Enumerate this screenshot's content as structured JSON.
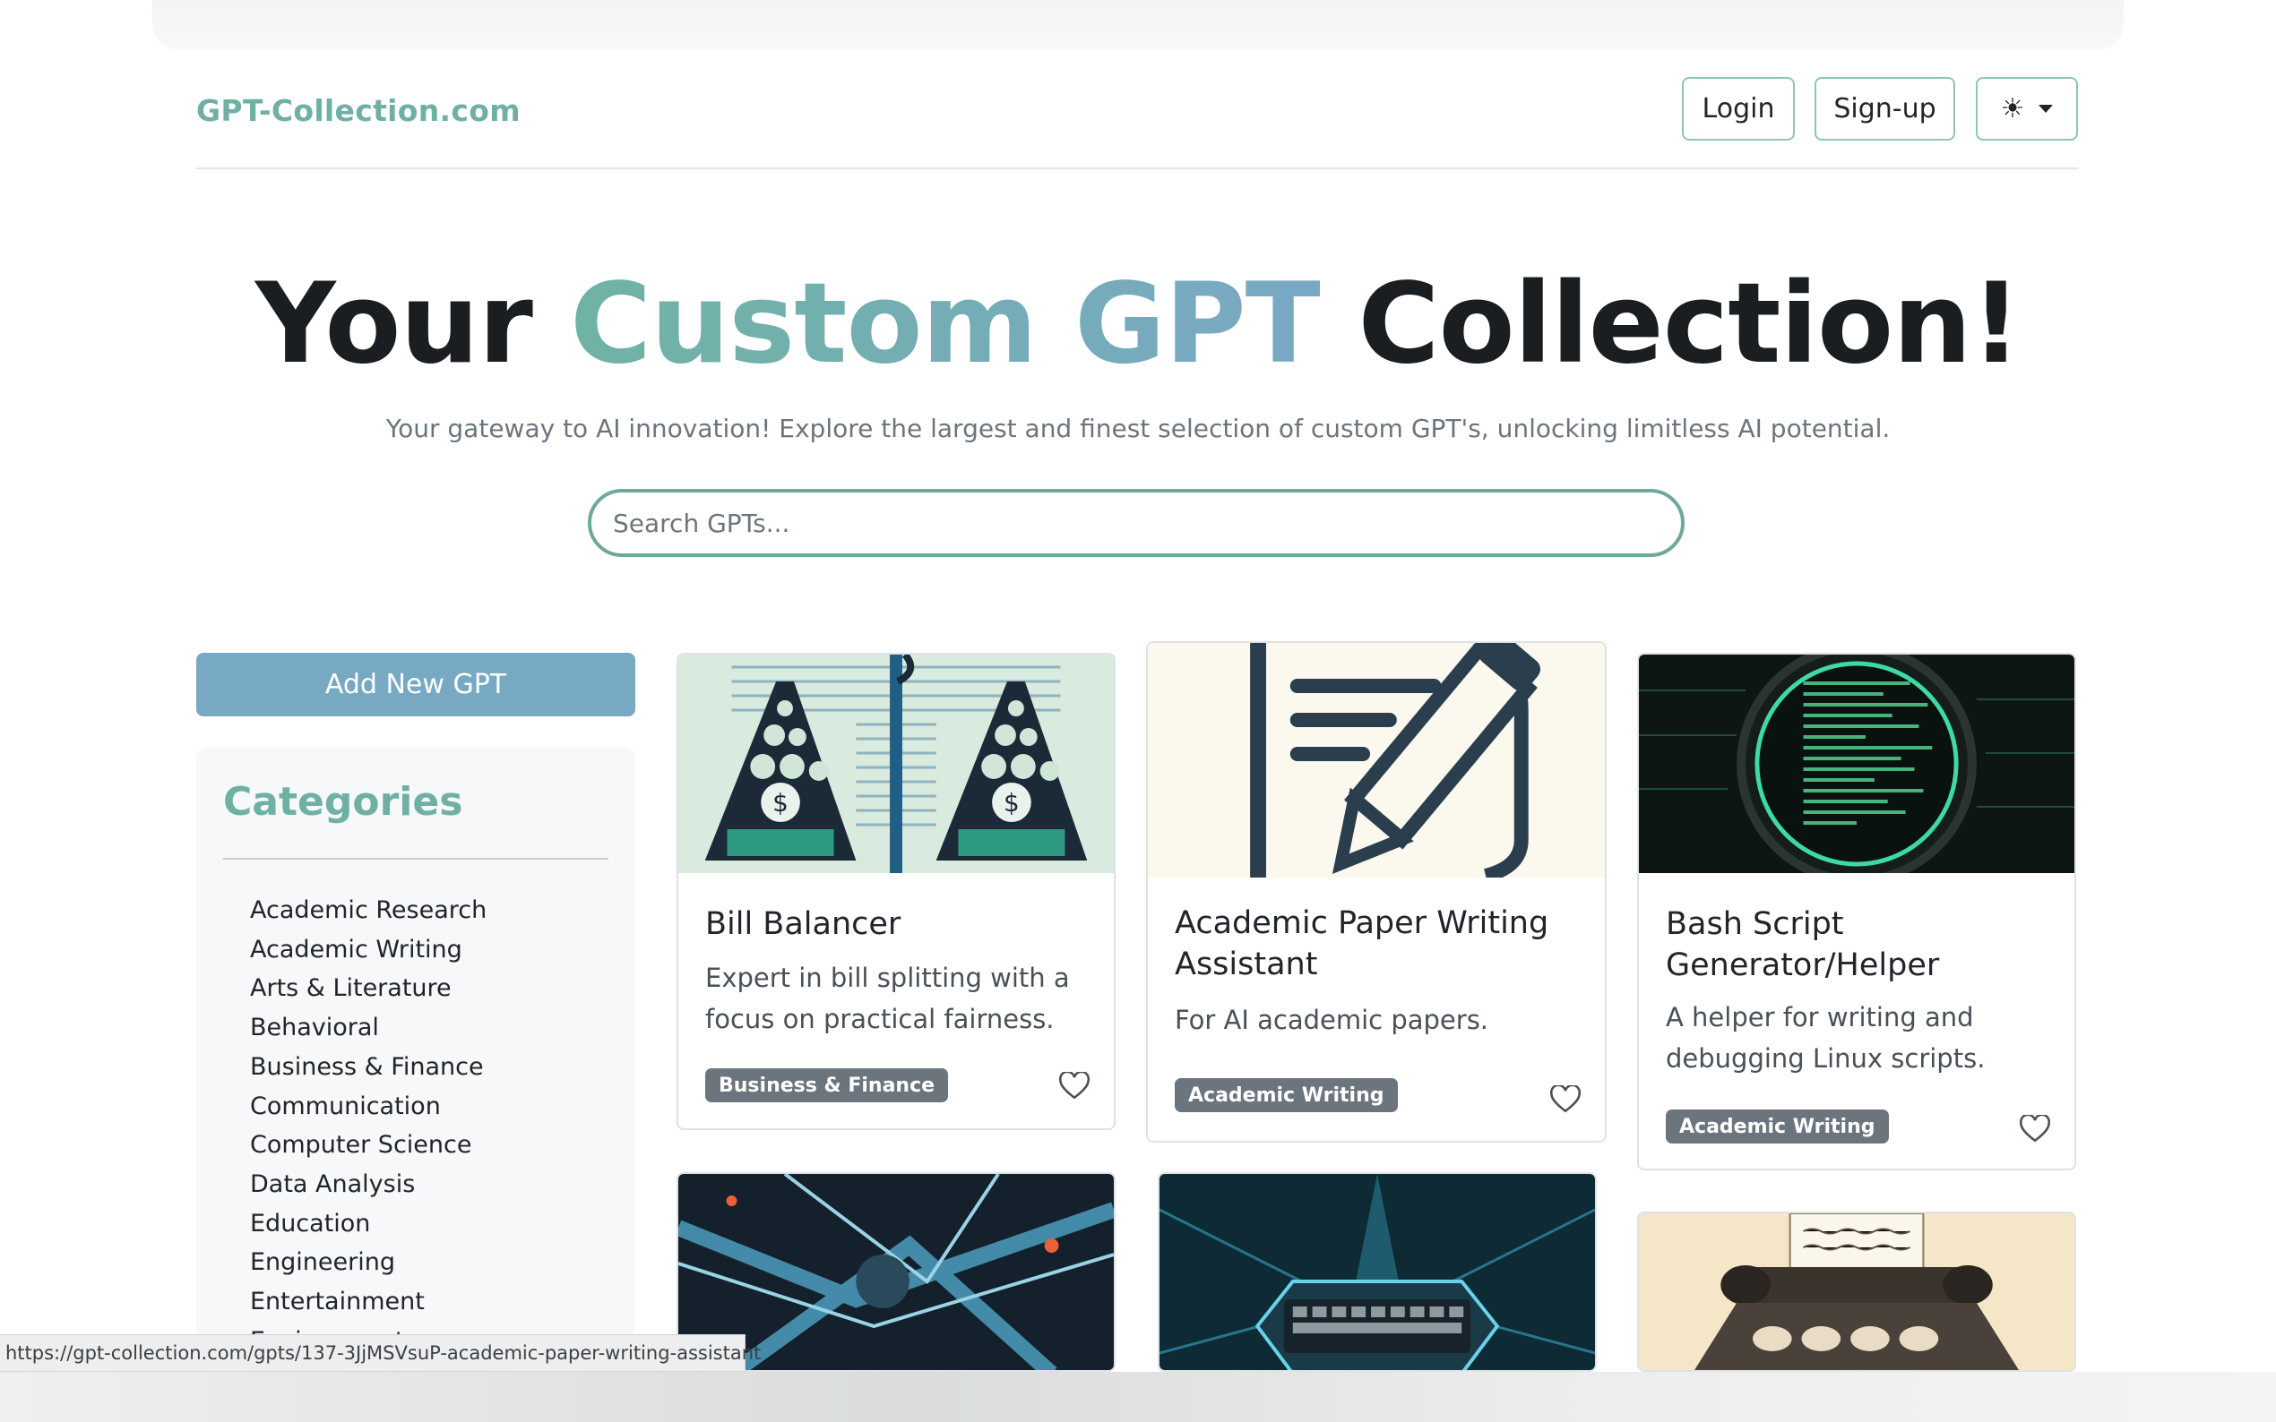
{
  "header": {
    "brand": "GPT-Collection.com",
    "login_label": "Login",
    "signup_label": "Sign-up",
    "theme_icon": "sun-icon"
  },
  "hero": {
    "title_start": "Your",
    "title_accent": "Custom GPT",
    "title_end": "Collection!",
    "subtitle": "Your gateway to AI innovation! Explore the largest and finest selection of custom GPT's, unlocking limitless AI potential."
  },
  "search": {
    "placeholder": "Search GPTs..."
  },
  "sidebar": {
    "add_label": "Add New GPT",
    "categories_title": "Categories",
    "categories": [
      "Academic Research",
      "Academic Writing",
      "Arts & Literature",
      "Behavioral",
      "Business & Finance",
      "Communication",
      "Computer Science",
      "Data Analysis",
      "Education",
      "Engineering",
      "Entertainment",
      "Environment"
    ]
  },
  "cards": [
    {
      "title": "Bill Balancer",
      "description": "Expert in bill splitting with a focus on practical fairness.",
      "badge": "Business & Finance"
    },
    {
      "title": "Academic Paper Writing Assistant",
      "description": "For AI academic papers.",
      "badge": "Academic Writing"
    },
    {
      "title": "Bash Script Generator/Helper",
      "description": "A helper for writing and debugging Linux scripts.",
      "badge": "Academic Writing"
    }
  ],
  "status_url": "https://gpt-collection.com/gpts/137-3JjMSVsuP-academic-paper-writing-assistant",
  "colors": {
    "brand": "#6fb0a4",
    "accent_blue": "#78a9c2",
    "badge": "#6c757d"
  }
}
